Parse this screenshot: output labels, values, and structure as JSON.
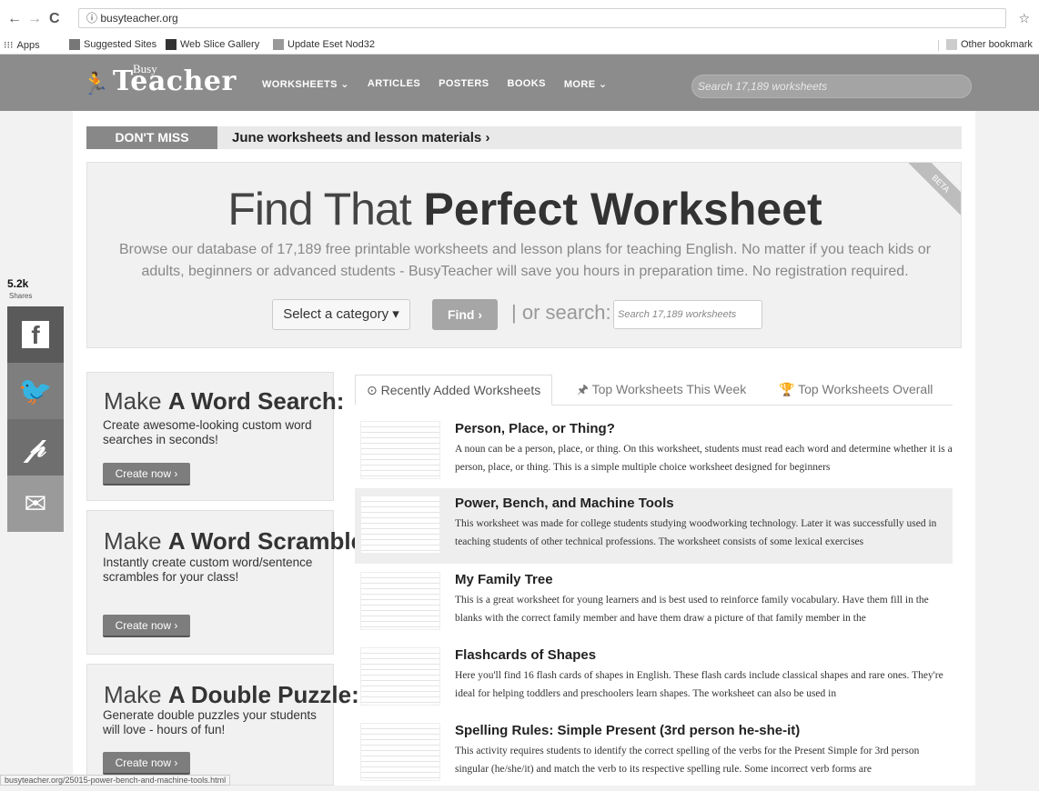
{
  "browser": {
    "back": "←",
    "forward": "→",
    "reload": "C",
    "url": "busyteacher.org",
    "star": "☆",
    "bookmarks": [
      "Apps",
      "Suggested Sites",
      "Web Slice Gallery",
      "Update Eset Nod32"
    ],
    "other_bookmarks": "Other bookmark"
  },
  "site": {
    "logo_small": "Busy",
    "logo_big": "Teacher",
    "nav": [
      "WORKSHEETS ⌄",
      "ARTICLES",
      "POSTERS",
      "BOOKS",
      "MORE ⌄"
    ],
    "search_placeholder": "Search 17,189 worksheets"
  },
  "dont_miss": {
    "label": "DON'T MISS",
    "text": "June worksheets and lesson materials ›"
  },
  "hero": {
    "beta": "BETA",
    "title_thin": "Find That",
    "title_bold": "Perfect Worksheet",
    "description": "Browse our database of 17,189 free printable worksheets and lesson plans for teaching English. No matter if you teach kids or adults, beginners or advanced students - BusyTeacher will save you hours in preparation time. No registration required.",
    "category_button": "Select a category ▾",
    "find_button": "Find ›",
    "or_search": "| or search:",
    "search_placeholder": "Search 17,189 worksheets"
  },
  "share": {
    "count": "5.2k",
    "label": "Shares",
    "colors": [
      "#5a5a5a",
      "#7e7e7e",
      "#6f6f6f",
      "#9a9a9a"
    ]
  },
  "promos": [
    {
      "thin": "Make",
      "bold": "A Word Search:",
      "desc": "Create awesome-looking custom word searches in seconds!",
      "button": "Create now ›"
    },
    {
      "thin": "Make",
      "bold": "A Word Scramble:",
      "desc": "Instantly create custom word/sentence scrambles for your class!",
      "button": "Create now ›"
    },
    {
      "thin": "Make",
      "bold": "A Double Puzzle:",
      "desc": "Generate double puzzles your students will love - hours of fun!",
      "button": "Create now ›"
    }
  ],
  "tabs": [
    "⊙ Recently Added Worksheets",
    "🖈 Top Worksheets This Week",
    "🏆 Top Worksheets Overall"
  ],
  "worksheets": [
    {
      "title": "Person, Place, or Thing?",
      "desc": "A noun can be a person, place, or thing. On this worksheet, students must read each word and determine whether it is a person, place, or thing. This is a simple multiple choice worksheet designed for beginners"
    },
    {
      "title": "Power, Bench, and Machine Tools",
      "desc": "This worksheet was made for college students studying woodworking technology. Later it was successfully used in teaching students of other technical professions. The worksheet consists of some lexical exercises"
    },
    {
      "title": "My Family Tree",
      "desc": "This is a great worksheet for young learners and is best used to reinforce family vocabulary. Have them fill in the blanks with the correct family member and have them draw a picture of that family member in the"
    },
    {
      "title": "Flashcards of Shapes",
      "desc": "Here you'll find 16 flash cards of shapes in English. These flash cards include classical shapes and rare ones. They're ideal for helping toddlers and preschoolers learn shapes. The worksheet can also be used in"
    },
    {
      "title": "Spelling Rules: Simple Present (3rd person he-she-it)",
      "desc": "This activity requires students to identify the correct spelling of the verbs for the Present Simple for 3rd person singular (he/she/it) and match the verb to its respective spelling rule. Some incorrect verb forms are"
    }
  ],
  "status_url": "busyteacher.org/25015-power-bench-and-machine-tools.html"
}
